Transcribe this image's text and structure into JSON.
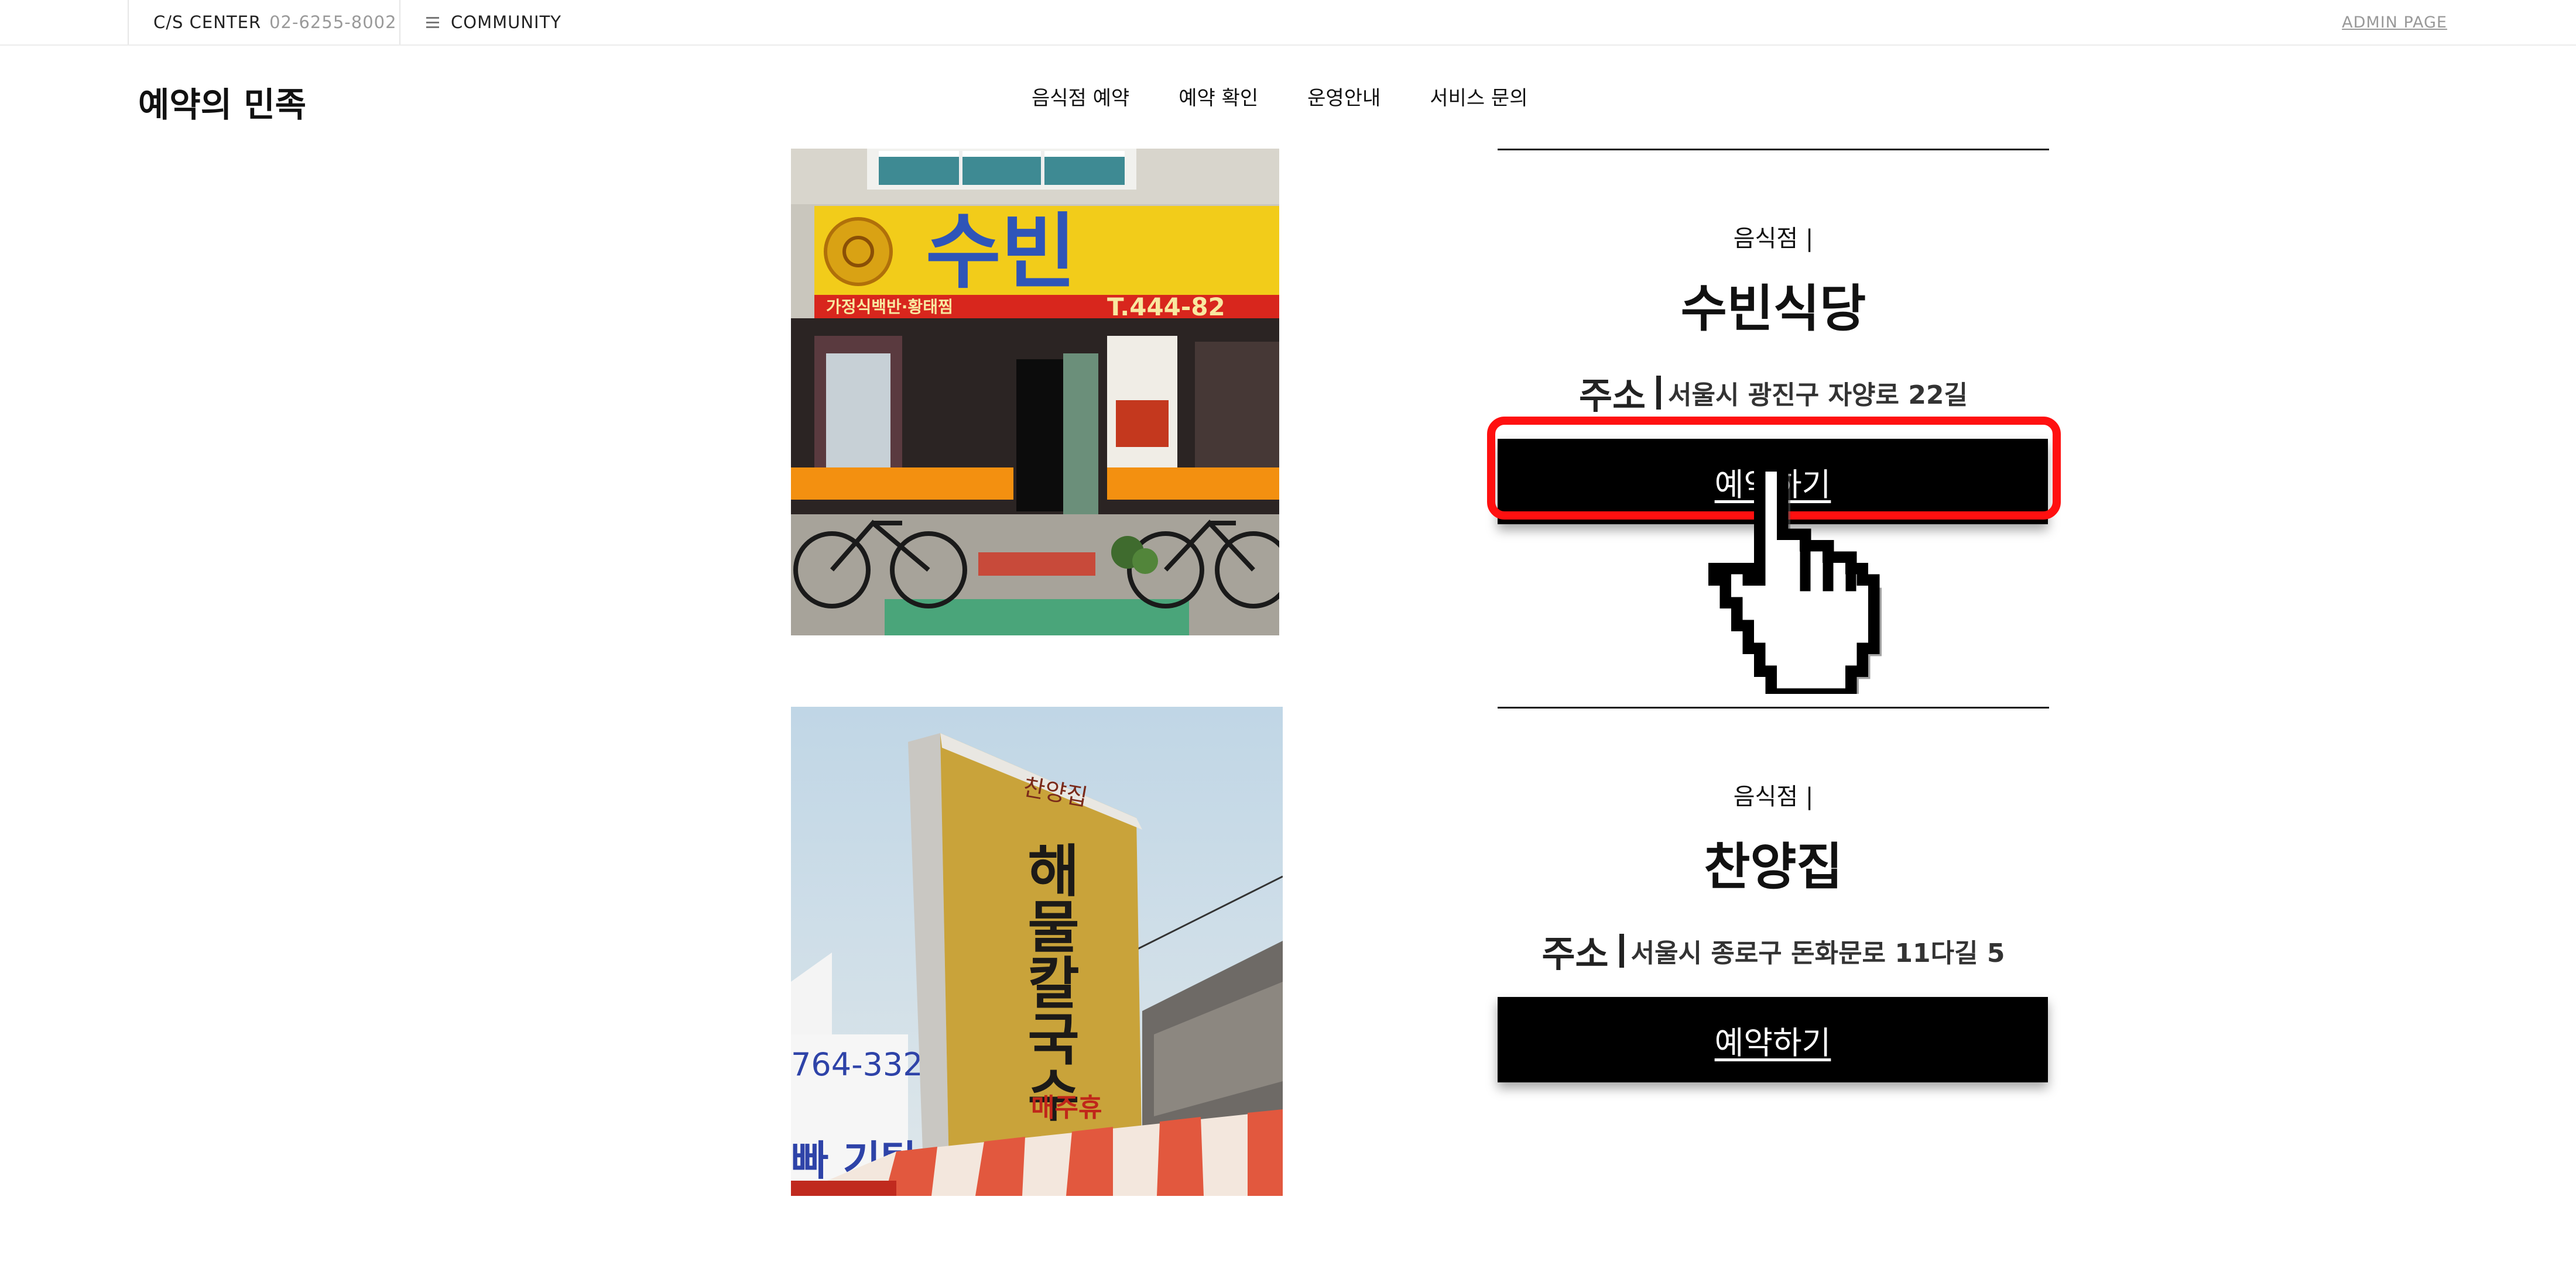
{
  "topbar": {
    "cs_label": "C/S CENTER",
    "cs_phone": "02-6255-8002",
    "community_label": "COMMUNITY",
    "admin_label": "ADMIN PAGE"
  },
  "header": {
    "logo": "예약의 민족",
    "nav": [
      "음식점 예약",
      "예약 확인",
      "운영안내",
      "서비스 문의"
    ]
  },
  "restaurants": [
    {
      "category": "음식점 |",
      "name": "수빈식당",
      "address_label": "주소",
      "address": "서울시 광진구 자양로 22길",
      "reserve_label": "예약하기",
      "photo_sign": "수빈",
      "photo_subsign": "가정식백반·황태찜",
      "photo_phone": "T.444-82"
    },
    {
      "category": "음식점 |",
      "name": "찬양집",
      "address_label": "주소",
      "address": "서울시 종로구 돈화문로 11다길 5",
      "reserve_label": "예약하기",
      "photo_sign_top": "찬양집",
      "photo_sign_main": "해물칼국수",
      "photo_sign_bottom": "매주휴",
      "photo_side_number": "764-332",
      "photo_side_text": "빠 기탕"
    }
  ],
  "colors": {
    "highlight": "#ff1010",
    "button_bg": "#000000",
    "button_text": "#ffffff"
  },
  "icons": [
    "hamburger-icon",
    "hand-pointer-icon"
  ]
}
